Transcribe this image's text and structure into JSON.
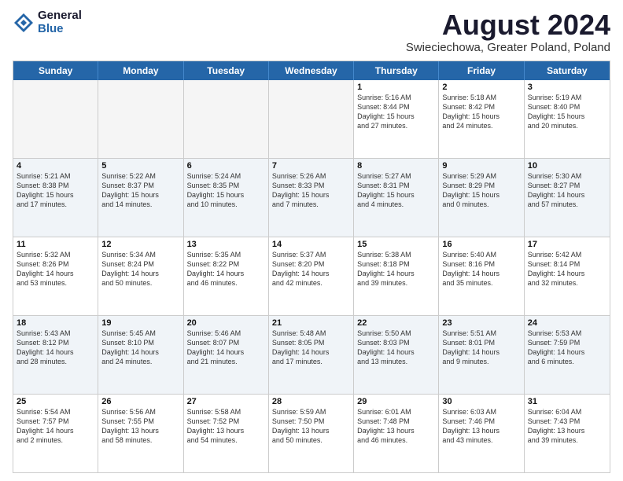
{
  "header": {
    "logo": {
      "general": "General",
      "blue": "Blue"
    },
    "title": "August 2024",
    "location": "Swieciechowa, Greater Poland, Poland"
  },
  "weekdays": [
    "Sunday",
    "Monday",
    "Tuesday",
    "Wednesday",
    "Thursday",
    "Friday",
    "Saturday"
  ],
  "rows": [
    [
      {
        "day": "",
        "info": ""
      },
      {
        "day": "",
        "info": ""
      },
      {
        "day": "",
        "info": ""
      },
      {
        "day": "",
        "info": ""
      },
      {
        "day": "1",
        "info": "Sunrise: 5:16 AM\nSunset: 8:44 PM\nDaylight: 15 hours\nand 27 minutes."
      },
      {
        "day": "2",
        "info": "Sunrise: 5:18 AM\nSunset: 8:42 PM\nDaylight: 15 hours\nand 24 minutes."
      },
      {
        "day": "3",
        "info": "Sunrise: 5:19 AM\nSunset: 8:40 PM\nDaylight: 15 hours\nand 20 minutes."
      }
    ],
    [
      {
        "day": "4",
        "info": "Sunrise: 5:21 AM\nSunset: 8:38 PM\nDaylight: 15 hours\nand 17 minutes."
      },
      {
        "day": "5",
        "info": "Sunrise: 5:22 AM\nSunset: 8:37 PM\nDaylight: 15 hours\nand 14 minutes."
      },
      {
        "day": "6",
        "info": "Sunrise: 5:24 AM\nSunset: 8:35 PM\nDaylight: 15 hours\nand 10 minutes."
      },
      {
        "day": "7",
        "info": "Sunrise: 5:26 AM\nSunset: 8:33 PM\nDaylight: 15 hours\nand 7 minutes."
      },
      {
        "day": "8",
        "info": "Sunrise: 5:27 AM\nSunset: 8:31 PM\nDaylight: 15 hours\nand 4 minutes."
      },
      {
        "day": "9",
        "info": "Sunrise: 5:29 AM\nSunset: 8:29 PM\nDaylight: 15 hours\nand 0 minutes."
      },
      {
        "day": "10",
        "info": "Sunrise: 5:30 AM\nSunset: 8:27 PM\nDaylight: 14 hours\nand 57 minutes."
      }
    ],
    [
      {
        "day": "11",
        "info": "Sunrise: 5:32 AM\nSunset: 8:26 PM\nDaylight: 14 hours\nand 53 minutes."
      },
      {
        "day": "12",
        "info": "Sunrise: 5:34 AM\nSunset: 8:24 PM\nDaylight: 14 hours\nand 50 minutes."
      },
      {
        "day": "13",
        "info": "Sunrise: 5:35 AM\nSunset: 8:22 PM\nDaylight: 14 hours\nand 46 minutes."
      },
      {
        "day": "14",
        "info": "Sunrise: 5:37 AM\nSunset: 8:20 PM\nDaylight: 14 hours\nand 42 minutes."
      },
      {
        "day": "15",
        "info": "Sunrise: 5:38 AM\nSunset: 8:18 PM\nDaylight: 14 hours\nand 39 minutes."
      },
      {
        "day": "16",
        "info": "Sunrise: 5:40 AM\nSunset: 8:16 PM\nDaylight: 14 hours\nand 35 minutes."
      },
      {
        "day": "17",
        "info": "Sunrise: 5:42 AM\nSunset: 8:14 PM\nDaylight: 14 hours\nand 32 minutes."
      }
    ],
    [
      {
        "day": "18",
        "info": "Sunrise: 5:43 AM\nSunset: 8:12 PM\nDaylight: 14 hours\nand 28 minutes."
      },
      {
        "day": "19",
        "info": "Sunrise: 5:45 AM\nSunset: 8:10 PM\nDaylight: 14 hours\nand 24 minutes."
      },
      {
        "day": "20",
        "info": "Sunrise: 5:46 AM\nSunset: 8:07 PM\nDaylight: 14 hours\nand 21 minutes."
      },
      {
        "day": "21",
        "info": "Sunrise: 5:48 AM\nSunset: 8:05 PM\nDaylight: 14 hours\nand 17 minutes."
      },
      {
        "day": "22",
        "info": "Sunrise: 5:50 AM\nSunset: 8:03 PM\nDaylight: 14 hours\nand 13 minutes."
      },
      {
        "day": "23",
        "info": "Sunrise: 5:51 AM\nSunset: 8:01 PM\nDaylight: 14 hours\nand 9 minutes."
      },
      {
        "day": "24",
        "info": "Sunrise: 5:53 AM\nSunset: 7:59 PM\nDaylight: 14 hours\nand 6 minutes."
      }
    ],
    [
      {
        "day": "25",
        "info": "Sunrise: 5:54 AM\nSunset: 7:57 PM\nDaylight: 14 hours\nand 2 minutes."
      },
      {
        "day": "26",
        "info": "Sunrise: 5:56 AM\nSunset: 7:55 PM\nDaylight: 13 hours\nand 58 minutes."
      },
      {
        "day": "27",
        "info": "Sunrise: 5:58 AM\nSunset: 7:52 PM\nDaylight: 13 hours\nand 54 minutes."
      },
      {
        "day": "28",
        "info": "Sunrise: 5:59 AM\nSunset: 7:50 PM\nDaylight: 13 hours\nand 50 minutes."
      },
      {
        "day": "29",
        "info": "Sunrise: 6:01 AM\nSunset: 7:48 PM\nDaylight: 13 hours\nand 46 minutes."
      },
      {
        "day": "30",
        "info": "Sunrise: 6:03 AM\nSunset: 7:46 PM\nDaylight: 13 hours\nand 43 minutes."
      },
      {
        "day": "31",
        "info": "Sunrise: 6:04 AM\nSunset: 7:43 PM\nDaylight: 13 hours\nand 39 minutes."
      }
    ]
  ]
}
